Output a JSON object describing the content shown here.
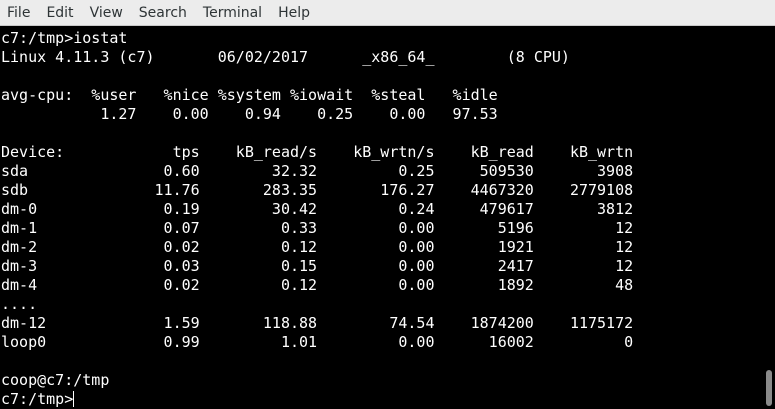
{
  "menubar": {
    "items": [
      "File",
      "Edit",
      "View",
      "Search",
      "Terminal",
      "Help"
    ]
  },
  "terminal": {
    "prompt_command": "c7:/tmp>iostat",
    "sysinfo": "Linux 4.11.3 (c7)       06/02/2017      _x86_64_        (8 CPU)",
    "blank1": "",
    "cpu_header": "avg-cpu:  %user   %nice %system %iowait  %steal   %idle",
    "cpu_values": "           1.27    0.00    0.94    0.25    0.00   97.53",
    "blank2": "",
    "device_header": "Device:            tps    kB_read/s    kB_wrtn/s    kB_read    kB_wrtn",
    "rows": [
      "sda               0.60        32.32         0.25     509530       3908",
      "sdb              11.76       283.35       176.27    4467320    2779108",
      "dm-0              0.19        30.42         0.24     479617       3812",
      "dm-1              0.07         0.33         0.00       5196         12",
      "dm-2              0.02         0.12         0.00       1921         12",
      "dm-3              0.03         0.15         0.00       2417         12",
      "dm-4              0.02         0.12         0.00       1892         48",
      "....",
      "dm-12             1.59       118.88        74.54    1874200    1175172",
      "loop0             0.99         1.01         0.00      16002          0"
    ],
    "blank3": "",
    "user_host": "coop@c7:/tmp",
    "prompt": "c7:/tmp>"
  },
  "colors": {
    "background": "#000000",
    "foreground": "#ffffff",
    "menubar": "#ececec"
  }
}
